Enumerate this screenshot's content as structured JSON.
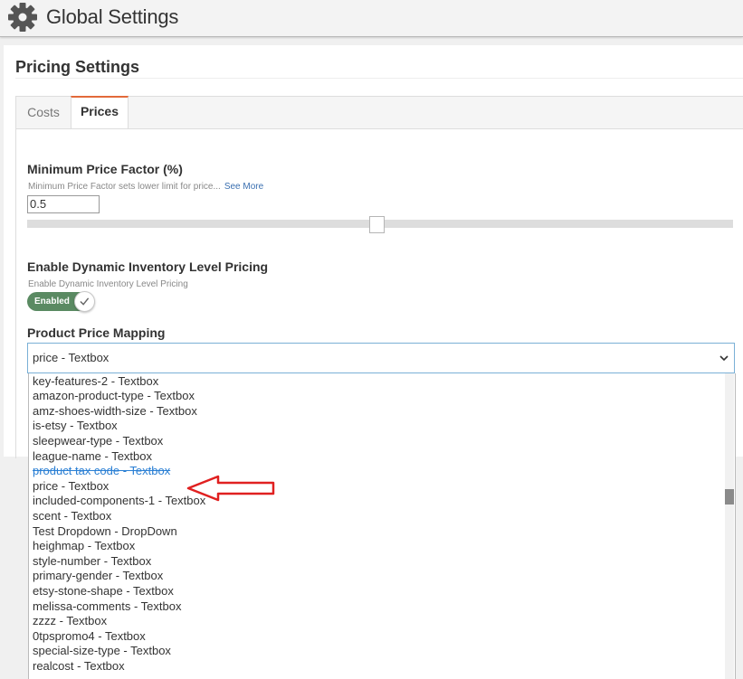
{
  "header": {
    "title": "Global Settings",
    "icon": "gear-icon"
  },
  "pricing": {
    "title": "Pricing Settings",
    "tabs": [
      {
        "label": "Costs",
        "active": false
      },
      {
        "label": "Prices",
        "active": true
      }
    ],
    "min_price_factor": {
      "label": "Minimum Price Factor (%)",
      "help": "Minimum Price Factor sets lower limit for price...",
      "see_more": "See More",
      "value": "0.5",
      "slider_level": 0.5
    },
    "dynamic_inventory": {
      "label": "Enable Dynamic Inventory Level Pricing",
      "help": "Enable Dynamic Inventory Level Pricing",
      "toggle_label": "Enabled",
      "enabled": true
    },
    "price_mapping": {
      "label": "Product Price Mapping",
      "selected": "price - Textbox",
      "options": [
        "key-features-2 - Textbox",
        "amazon-product-type - Textbox",
        "amz-shoes-width-size - Textbox",
        "is-etsy - Textbox",
        "sleepwear-type - Textbox",
        "league-name - Textbox",
        "product tax code - Textbox",
        "price - Textbox",
        "included-components-1 - Textbox",
        "scent - Textbox",
        "Test Dropdown - DropDown",
        "heighmap - Textbox",
        "style-number - Textbox",
        "primary-gender - Textbox",
        "etsy-stone-shape - Textbox",
        "melissa-comments - Textbox",
        "zzzz - Textbox",
        "0tpspromo4 - Textbox",
        "special-size-type - Textbox",
        "realcost - Textbox"
      ],
      "highlighted_index": 6,
      "arrow_target_index": 7
    }
  },
  "colors": {
    "tab_accent": "#e26a3a",
    "toggle_on": "#5a8a62",
    "link": "#3a6fb0",
    "annotation_arrow": "#e02020"
  }
}
